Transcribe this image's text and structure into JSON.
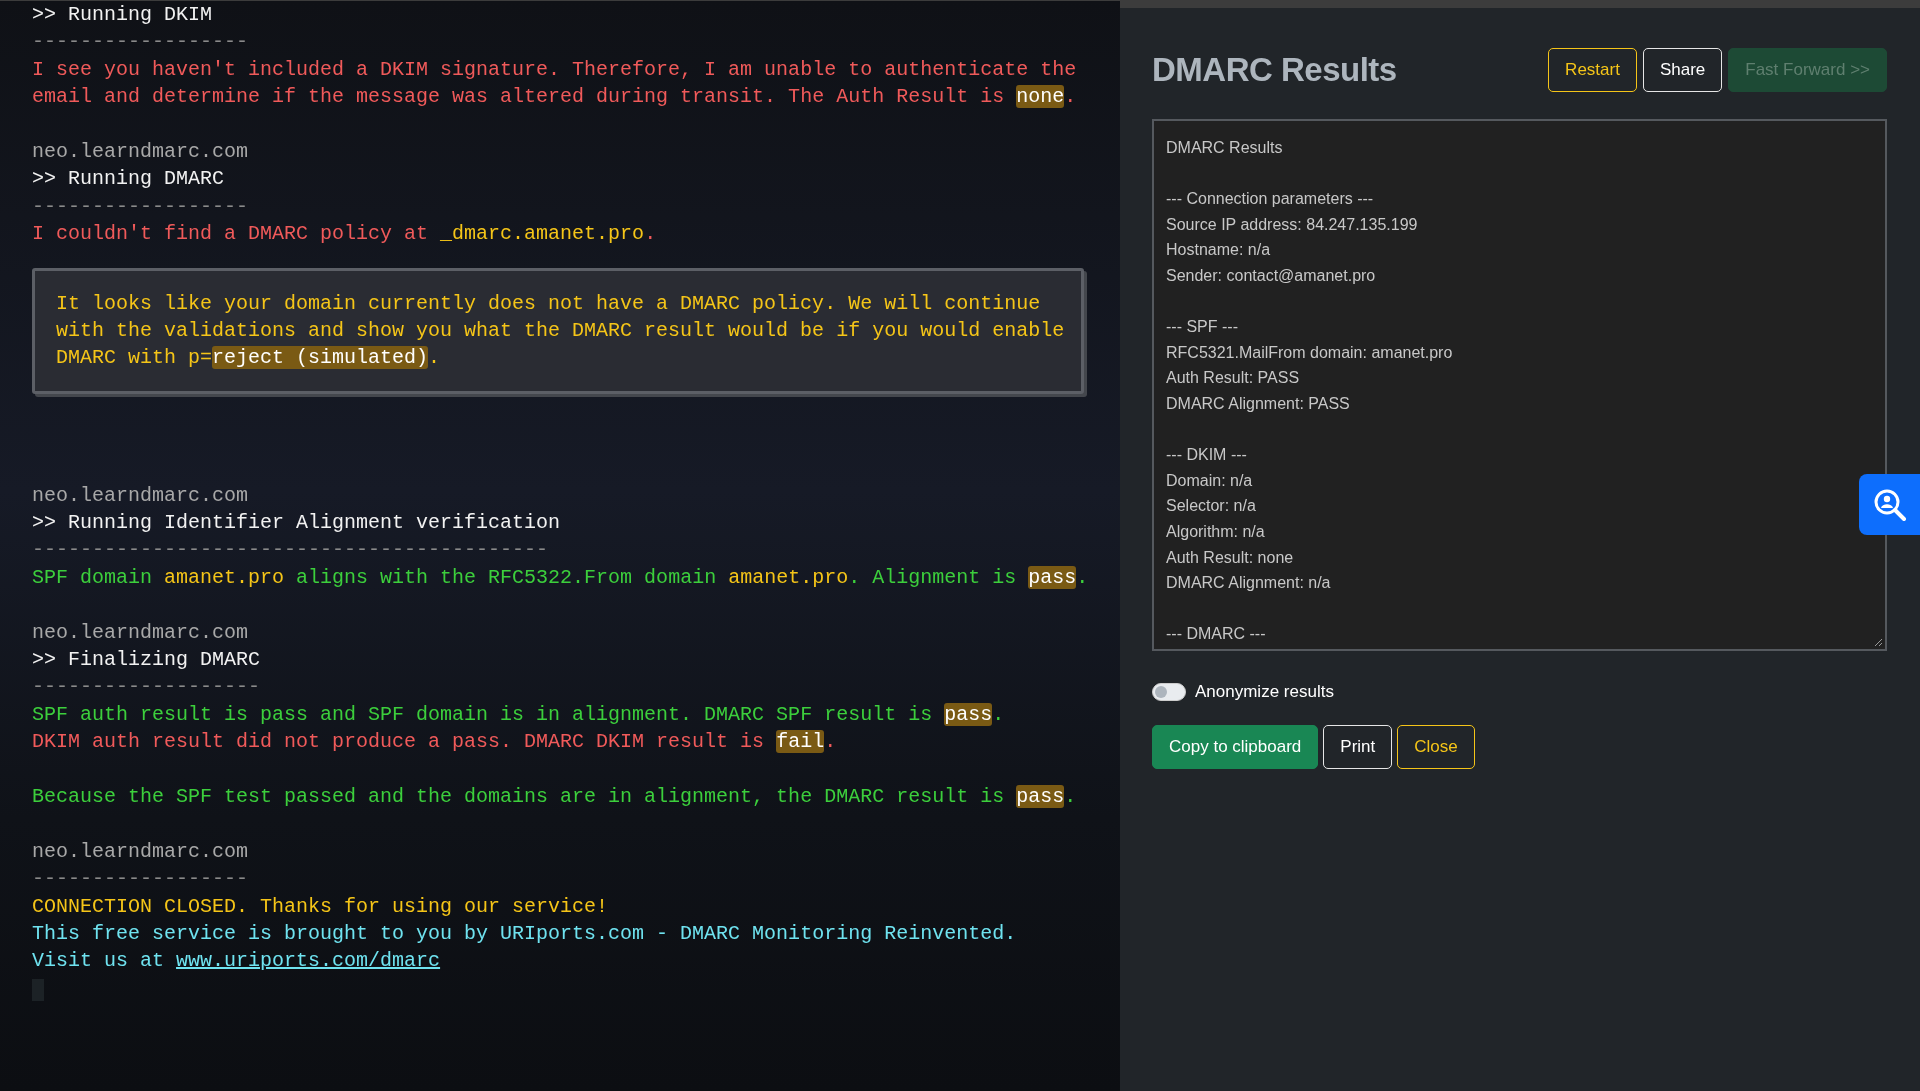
{
  "terminal": {
    "blocks": [
      {
        "kind": "output",
        "lines": [
          {
            "kind": "command",
            "segments": [
              {
                "kind": "plain",
                "text": ">> Running DKIM"
              }
            ]
          },
          {
            "kind": "divider",
            "segments": [
              {
                "kind": "plain",
                "text": "------------------"
              }
            ]
          },
          {
            "kind": "error",
            "segments": [
              {
                "kind": "plain",
                "text": "I see you haven't included a DKIM signature. Therefore, I am unable to authenticate the"
              }
            ]
          },
          {
            "kind": "error",
            "segments": [
              {
                "kind": "plain",
                "text": "email and determine if the message was altered during transit. The Auth Result is "
              },
              {
                "kind": "badge",
                "text": "none"
              },
              {
                "kind": "plain",
                "text": "."
              }
            ]
          }
        ]
      },
      {
        "kind": "output",
        "lines": [
          {
            "kind": "host",
            "segments": [
              {
                "kind": "plain",
                "text": "neo.learndmarc.com"
              }
            ]
          },
          {
            "kind": "command",
            "segments": [
              {
                "kind": "plain",
                "text": ">> Running DMARC"
              }
            ]
          },
          {
            "kind": "divider",
            "segments": [
              {
                "kind": "plain",
                "text": "------------------"
              }
            ]
          },
          {
            "kind": "error",
            "segments": [
              {
                "kind": "plain",
                "text": "I couldn't find a DMARC policy at "
              },
              {
                "kind": "accent",
                "text": "_dmarc.amanet.pro"
              },
              {
                "kind": "plain",
                "text": "."
              }
            ]
          }
        ]
      },
      {
        "kind": "notice",
        "lines": [
          {
            "kind": "warning",
            "segments": [
              {
                "kind": "plain",
                "text": "It looks like your domain currently does not have a DMARC policy. We will continue"
              }
            ]
          },
          {
            "kind": "warning",
            "segments": [
              {
                "kind": "plain",
                "text": "with the validations and show you what the DMARC result would be if you would enable"
              }
            ]
          },
          {
            "kind": "warning",
            "segments": [
              {
                "kind": "plain",
                "text": "DMARC with p="
              },
              {
                "kind": "badge",
                "text": "reject (simulated)"
              },
              {
                "kind": "plain",
                "text": "."
              }
            ]
          }
        ]
      },
      {
        "kind": "output",
        "lines": [
          {
            "kind": "host",
            "segments": [
              {
                "kind": "plain",
                "text": "neo.learndmarc.com"
              }
            ]
          },
          {
            "kind": "command",
            "segments": [
              {
                "kind": "plain",
                "text": ">> Running Identifier Alignment verification"
              }
            ]
          },
          {
            "kind": "divider",
            "segments": [
              {
                "kind": "plain",
                "text": "-------------------------------------------"
              }
            ]
          },
          {
            "kind": "success",
            "segments": [
              {
                "kind": "plain",
                "text": "SPF domain "
              },
              {
                "kind": "accent",
                "text": "amanet.pro"
              },
              {
                "kind": "plain",
                "text": " aligns with the RFC5322.From domain "
              },
              {
                "kind": "accent",
                "text": "amanet.pro"
              },
              {
                "kind": "plain",
                "text": ". Alignment is "
              },
              {
                "kind": "badge",
                "text": "pass"
              },
              {
                "kind": "plain",
                "text": "."
              }
            ]
          }
        ]
      },
      {
        "kind": "output",
        "lines": [
          {
            "kind": "host",
            "segments": [
              {
                "kind": "plain",
                "text": "neo.learndmarc.com"
              }
            ]
          },
          {
            "kind": "command",
            "segments": [
              {
                "kind": "plain",
                "text": ">> Finalizing DMARC"
              }
            ]
          },
          {
            "kind": "divider",
            "segments": [
              {
                "kind": "plain",
                "text": "-------------------"
              }
            ]
          },
          {
            "kind": "success",
            "segments": [
              {
                "kind": "plain",
                "text": "SPF auth result is pass and SPF domain is in alignment. DMARC SPF result is "
              },
              {
                "kind": "badge",
                "text": "pass"
              },
              {
                "kind": "plain",
                "text": "."
              }
            ]
          },
          {
            "kind": "error",
            "segments": [
              {
                "kind": "plain",
                "text": "DKIM auth result did not produce a pass. DMARC DKIM result is "
              },
              {
                "kind": "badge",
                "text": "fail"
              },
              {
                "kind": "plain",
                "text": "."
              }
            ]
          }
        ]
      },
      {
        "kind": "output",
        "lines": [
          {
            "kind": "success",
            "segments": [
              {
                "kind": "plain",
                "text": "Because the SPF test passed and the domains are in alignment, the DMARC result is "
              },
              {
                "kind": "badge",
                "text": "pass"
              },
              {
                "kind": "plain",
                "text": "."
              }
            ]
          }
        ]
      },
      {
        "kind": "output",
        "lines": [
          {
            "kind": "host",
            "segments": [
              {
                "kind": "plain",
                "text": "neo.learndmarc.com"
              }
            ]
          },
          {
            "kind": "divider",
            "segments": [
              {
                "kind": "plain",
                "text": "------------------"
              }
            ]
          },
          {
            "kind": "warning",
            "segments": [
              {
                "kind": "plain",
                "text": "CONNECTION CLOSED. Thanks for using our service!"
              }
            ]
          },
          {
            "kind": "info",
            "segments": [
              {
                "kind": "plain",
                "text": "This free service is brought to you by URIports.com - DMARC Monitoring Reinvented."
              }
            ]
          },
          {
            "kind": "info",
            "segments": [
              {
                "kind": "plain",
                "text": "Visit us at "
              },
              {
                "kind": "link",
                "text": "www.uriports.com/dmarc"
              }
            ]
          }
        ]
      }
    ]
  },
  "results": {
    "title": "DMARC Results",
    "header_buttons": [
      {
        "label": "Restart",
        "kind": "warning",
        "disabled": false
      },
      {
        "label": "Share",
        "kind": "light",
        "disabled": false
      },
      {
        "label": "Fast Forward >>",
        "kind": "success",
        "disabled": true
      }
    ],
    "report": {
      "heading": "DMARC Results",
      "sections": [
        {
          "title": "--- Connection parameters ---",
          "lines": [
            "Source IP address: 84.247.135.199",
            "Hostname: n/a",
            "Sender: contact@amanet.pro"
          ]
        },
        {
          "title": "--- SPF ---",
          "lines": [
            "RFC5321.MailFrom domain: amanet.pro",
            "Auth Result: PASS",
            "DMARC Alignment: PASS"
          ]
        },
        {
          "title": "--- DKIM ---",
          "lines": [
            "Domain: n/a",
            "Selector: n/a",
            "Algorithm: n/a",
            "Auth Result: none",
            "DMARC Alignment: n/a"
          ]
        },
        {
          "title": "--- DMARC ---"
        }
      ]
    },
    "anonymize": {
      "label": "Anonymize results",
      "on": false
    },
    "footer_buttons": [
      {
        "label": "Copy to clipboard",
        "kind": "success",
        "disabled": false
      },
      {
        "label": "Print",
        "kind": "light",
        "disabled": false
      },
      {
        "label": "Close",
        "kind": "warning",
        "disabled": false
      }
    ]
  }
}
